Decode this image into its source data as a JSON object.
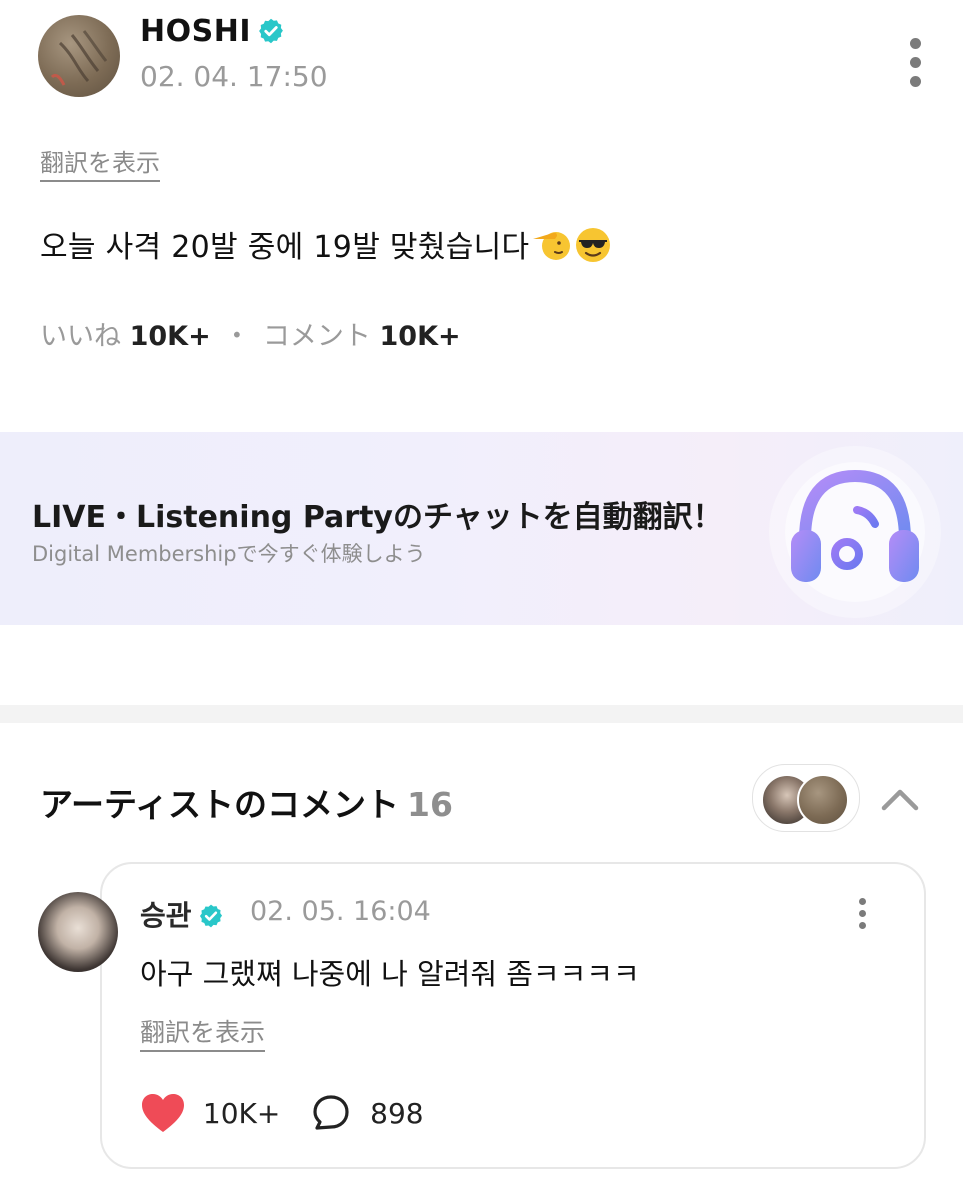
{
  "post": {
    "author": "HOSHI",
    "time": "02. 04. 17:50",
    "translate_label": "翻訳を表示",
    "text": "오늘 사격 20발 중에 19발 맞췄습니다",
    "emojis": [
      "saluting-face",
      "smiling-face-with-sunglasses"
    ],
    "stats": {
      "likes_label": "いいね",
      "likes_count": "10K+",
      "separator": "・",
      "comments_label": "コメント",
      "comments_count": "10K+"
    }
  },
  "banner": {
    "title": "LIVE・Listening Partyのチャットを自動翻訳！",
    "subtitle": "Digital Membershipで今すぐ体験しよう",
    "icon": "headphones-music-icon",
    "colors": {
      "headphone": "#9c7af5",
      "ear_cups": "#6f8bf0"
    }
  },
  "artist_comments": {
    "title": "アーティストのコメント",
    "count": "16"
  },
  "comment": {
    "author": "승관",
    "time": "02. 05. 16:04",
    "text": "아구 그랬쪄 나중에 나 알려줘 좀ㅋㅋㅋㅋ",
    "translate_label": "翻訳を表示",
    "likes": "10K+",
    "replies": "898",
    "colors": {
      "heart": "#ef4b57"
    }
  },
  "colors": {
    "verified": "#29c7c9"
  }
}
